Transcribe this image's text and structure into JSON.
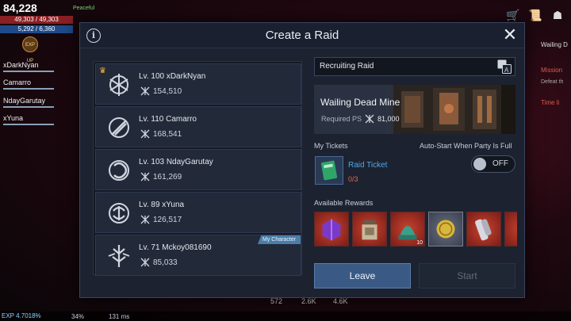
{
  "hud": {
    "score": "84,228",
    "hp": "49,303 / 49,303",
    "mp": "5,292 / 6,360",
    "status": "Peaceful",
    "exp_badge": "EXP UP",
    "exp_text": "EXP 4.7018%",
    "battery": "34%",
    "ping": "131 ms",
    "bottom_values": [
      "572",
      "2.6K",
      "4.6K"
    ],
    "side_quest": {
      "title": "Wailing D",
      "mission": "Mission",
      "mission_desc": "Defeat th",
      "timer": "Time li"
    }
  },
  "party_sidebar": [
    "xDarkNyan",
    "Camarro",
    "NdayGarutay",
    "xYuna"
  ],
  "modal": {
    "title": "Create a Raid",
    "info_icon": "i",
    "close_icon": "✕"
  },
  "members": [
    {
      "level": "Lv. 100 xDarkNyan",
      "ps": "154,510",
      "leader": true,
      "me": false
    },
    {
      "level": "Lv. 110 Camarro",
      "ps": "168,541",
      "leader": false,
      "me": false
    },
    {
      "level": "Lv. 103 NdayGarutay",
      "ps": "161,269",
      "leader": false,
      "me": false
    },
    {
      "level": "Lv. 89 xYuna",
      "ps": "126,517",
      "leader": false,
      "me": false
    },
    {
      "level": "Lv. 71 Mckoy081690",
      "ps": "85,033",
      "leader": false,
      "me": true
    }
  ],
  "my_character_tag": "My Character",
  "raid": {
    "type": "Recruiting Raid",
    "dungeon_name": "Wailing Dead Mine",
    "required_ps_label": "Required PS",
    "required_ps": "81,000"
  },
  "tickets": {
    "label": "My Tickets",
    "name": "Raid Ticket",
    "count": "0/3"
  },
  "autostart": {
    "label": "Auto-Start When Party Is Full",
    "state": "OFF"
  },
  "rewards": {
    "label": "Available Rewards",
    "items": [
      {
        "name": "purple-chest-icon",
        "count": ""
      },
      {
        "name": "lantern-jar-icon",
        "count": ""
      },
      {
        "name": "jade-relic-icon",
        "count": "10"
      },
      {
        "name": "gold-coin-icon",
        "count": ""
      },
      {
        "name": "gauntlet-armor-icon",
        "count": ""
      },
      {
        "name": "partial-item-icon",
        "count": ""
      }
    ]
  },
  "buttons": {
    "leave": "Leave",
    "start": "Start"
  },
  "colors": {
    "modal_bg": "#1c2230",
    "accent_blue": "#3a5a85",
    "ticket_link": "#4fa8e8",
    "ticket_count": "#e06a4a",
    "leader_crown": "#f2b53a"
  }
}
